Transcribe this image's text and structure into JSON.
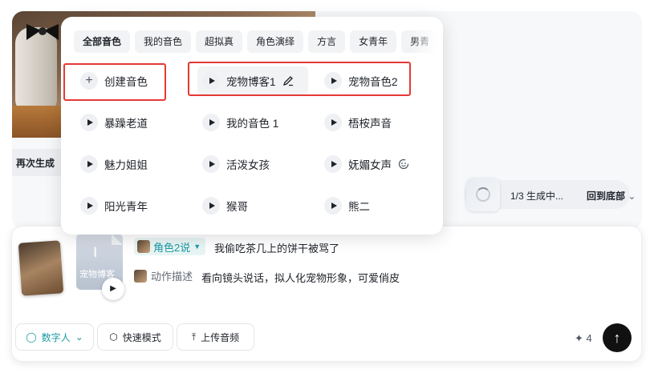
{
  "background": {
    "regenerate_label": "再次生成",
    "progress_label": "1/3 生成中...",
    "scroll_bottom_label": "回到底部"
  },
  "voice_panel": {
    "tabs": [
      "全部音色",
      "我的音色",
      "超拟真",
      "角色演绎",
      "方言",
      "女青年",
      "男青"
    ],
    "create_label": "创建音色",
    "voices": [
      "宠物博客1",
      "宠物音色2",
      "暴躁老道",
      "我的音色 1",
      "梧桉声音",
      "魅力姐姐",
      "活泼女孩",
      "妩媚女声",
      "阳光青年",
      "猴哥",
      "熊二"
    ]
  },
  "input": {
    "audio_file_name": "宠物博客",
    "role_label": "角色2说",
    "role_text": "我偷吃茶几上的饼干被骂了",
    "action_label": "动作描述",
    "action_text": "看向镜头说话，拟人化宠物形象，可爱俏皮",
    "digital_human_label": "数字人",
    "fast_mode_label": "快速模式",
    "upload_audio_label": "上传音频",
    "credits": "4"
  },
  "colors": {
    "accent": "#1b9aa3",
    "highlight_box": "#e53935"
  }
}
